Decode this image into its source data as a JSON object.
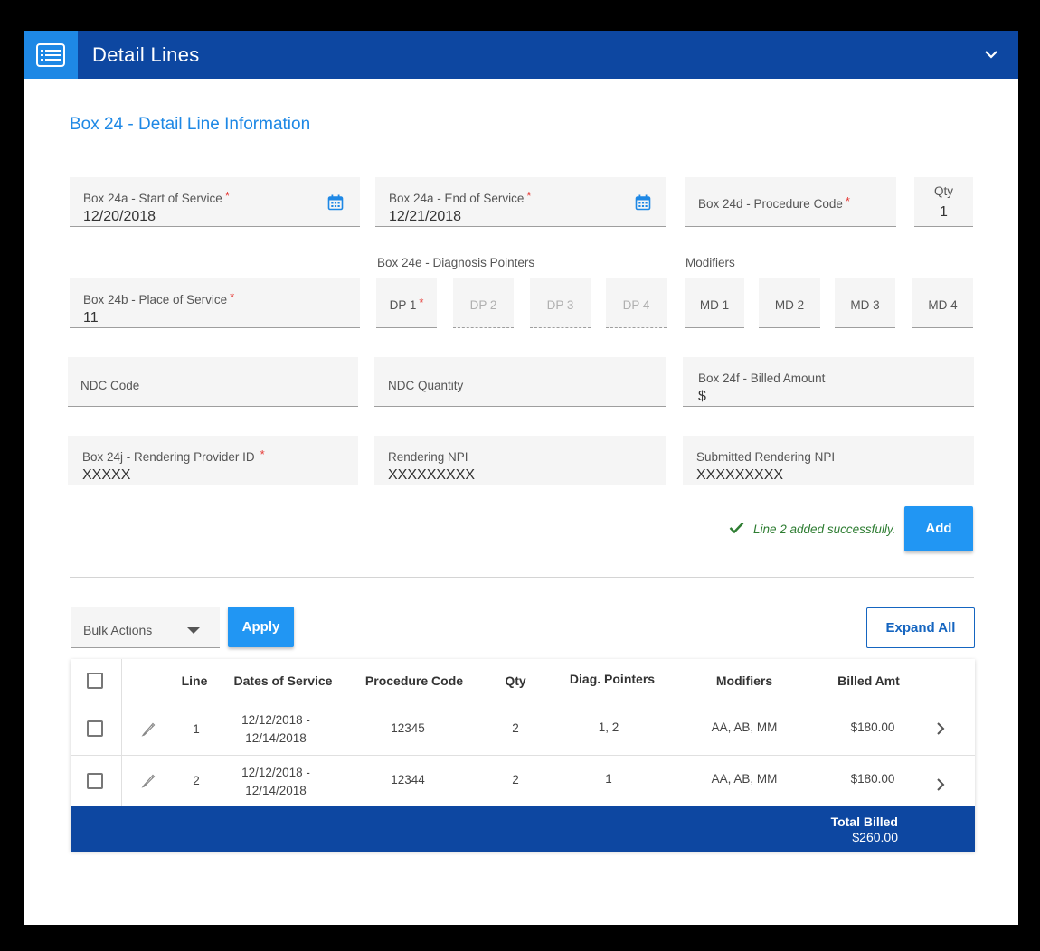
{
  "header": {
    "title": "Detail Lines",
    "icon": "list-icon",
    "toggle_icon": "chevron-down-icon"
  },
  "section": {
    "title": "Box 24 - Detail Line Information"
  },
  "form": {
    "start_of_service": {
      "label": "Box 24a - Start of Service",
      "required": "*",
      "value": "12/20/2018"
    },
    "end_of_service": {
      "label": "Box 24a - End of Service",
      "required": "*",
      "value": "12/21/2018"
    },
    "procedure_code": {
      "label": "Box 24d - Procedure Code",
      "required": "*",
      "value": ""
    },
    "qty": {
      "label": "Qty",
      "value": "1"
    },
    "place_of_service": {
      "label": "Box 24b - Place of Service",
      "required": "*",
      "value": "11"
    },
    "diagnosis_pointers": {
      "label": "Box 24e - Diagnosis Pointers",
      "dp1": {
        "label": "DP 1",
        "required": "*"
      },
      "dp2": "DP 2",
      "dp3": "DP 3",
      "dp4": "DP 4"
    },
    "modifiers": {
      "label": "Modifiers",
      "md1": "MD 1",
      "md2": "MD 2",
      "md3": "MD 3",
      "md4": "MD 4"
    },
    "ndc_code": {
      "label": "NDC Code"
    },
    "ndc_quantity": {
      "label": "NDC Quantity"
    },
    "billed_amount": {
      "label": "Box 24f - Billed Amount",
      "value": "$"
    },
    "rendering_provider_id": {
      "label": "Box 24j - Rendering Provider ID",
      "required": "*",
      "value": "XXXXX"
    },
    "rendering_npi": {
      "label": "Rendering NPI",
      "value": "XXXXXXXXX"
    },
    "submitted_rendering_npi": {
      "label": "Submitted Rendering NPI",
      "value": "XXXXXXXXX"
    },
    "success_message": "Line 2 added successfully.",
    "add_label": "Add"
  },
  "actions": {
    "bulk_actions": "Bulk Actions",
    "apply_label": "Apply",
    "expand_all_label": "Expand All"
  },
  "table": {
    "headers": {
      "line": "Line",
      "dates": "Dates of Service",
      "procedure": "Procedure Code",
      "qty": "Qty",
      "diag": "Diag. Pointers",
      "modifiers": "Modifiers",
      "billed": "Billed Amt"
    },
    "rows": [
      {
        "line": "1",
        "date_from": "12/12/2018 -",
        "date_to": "12/14/2018",
        "procedure": "12345",
        "qty": "2",
        "diag": "1, 2",
        "modifiers": "AA, AB, MM",
        "billed": "$180.00"
      },
      {
        "line": "2",
        "date_from": "12/12/2018 -",
        "date_to": "12/14/2018",
        "procedure": "12344",
        "qty": "2",
        "diag": "1",
        "modifiers": "AA, AB, MM",
        "billed": "$180.00"
      }
    ],
    "footer": {
      "label": "Total Billed",
      "value": "$260.00"
    }
  },
  "colors": {
    "header_bg": "#0d47a1",
    "accent": "#1e88e5",
    "primary_button": "#2196f3",
    "required": "#e53935",
    "success": "#2e7d32"
  }
}
